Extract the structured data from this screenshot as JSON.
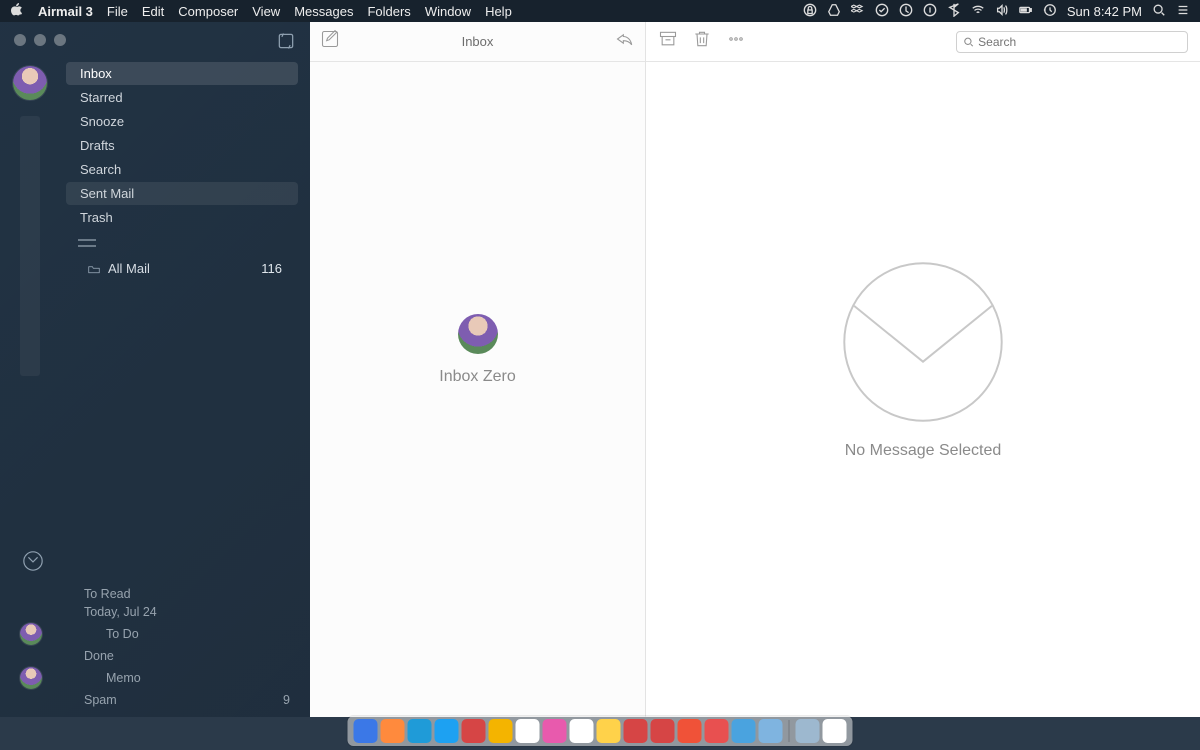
{
  "menubar": {
    "app_name": "Airmail 3",
    "items": [
      "File",
      "Edit",
      "Composer",
      "View",
      "Messages",
      "Folders",
      "Window",
      "Help"
    ],
    "clock": "Sun 8:42 PM"
  },
  "sidebar": {
    "folders": [
      {
        "label": "Inbox",
        "selected": true
      },
      {
        "label": "Starred"
      },
      {
        "label": "Snooze"
      },
      {
        "label": "Drafts"
      },
      {
        "label": "Search"
      },
      {
        "label": "Sent Mail",
        "hovered": true
      },
      {
        "label": "Trash"
      }
    ],
    "all_mail": {
      "label": "All Mail",
      "count": "116"
    },
    "smart": [
      {
        "label": "To Read"
      },
      {
        "label": "Today, Jul 24"
      },
      {
        "label": "To Do"
      },
      {
        "label": "Done"
      },
      {
        "label": "Memo"
      },
      {
        "label": "Spam",
        "count": "9"
      }
    ]
  },
  "list": {
    "title": "Inbox",
    "empty_text": "Inbox Zero"
  },
  "reader": {
    "empty_text": "No Message Selected",
    "search_placeholder": "Search"
  },
  "dock_colors": [
    "#3b78e7",
    "#ff8a3d",
    "#1f9bd8",
    "#1da1f2",
    "#d64545",
    "#f4b400",
    "#ffffff",
    "#e85aad",
    "#ffffff",
    "#ffd24a",
    "#d64545",
    "#d64545",
    "#f05238",
    "#e85050",
    "#4aa3df",
    "#7fb4e0",
    "#9db8cf",
    "#ffffff"
  ]
}
